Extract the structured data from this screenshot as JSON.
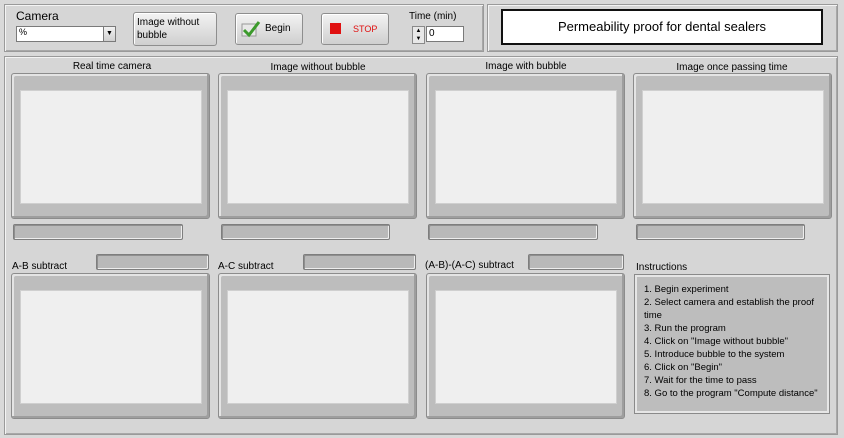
{
  "toolbar": {
    "camera_label": "Camera",
    "camera_prefix": "%",
    "camera_value": "",
    "image_without_bubble_button": "Image without bubble",
    "begin_button": "Begin",
    "stop_button": "STOP",
    "time_label": "Time (min)",
    "time_value": "0"
  },
  "title": "Permeability proof for dental sealers",
  "top_panels": [
    {
      "caption": "Real time camera"
    },
    {
      "caption": "Image without bubble"
    },
    {
      "caption": "Image with bubble"
    },
    {
      "caption": "Image once passing time"
    }
  ],
  "bottom_panels": [
    {
      "caption": "A-B subtract"
    },
    {
      "caption": "A-C subtract"
    },
    {
      "caption": "(A-B)-(A-C) subtract"
    }
  ],
  "instructions": {
    "title": "Instructions",
    "steps": [
      "1. Begin experiment",
      "2. Select camera and establish the proof time",
      "3. Run the program",
      "4. Click on \"Image without bubble\"",
      "5. Introduce bubble to the system",
      "6. Click on \"Begin\"",
      "7. Wait for the time to pass",
      "8. Go to the program \"Compute distance\""
    ]
  },
  "colors": {
    "stop_red": "#e01010",
    "check_green": "#3c9a2c"
  }
}
